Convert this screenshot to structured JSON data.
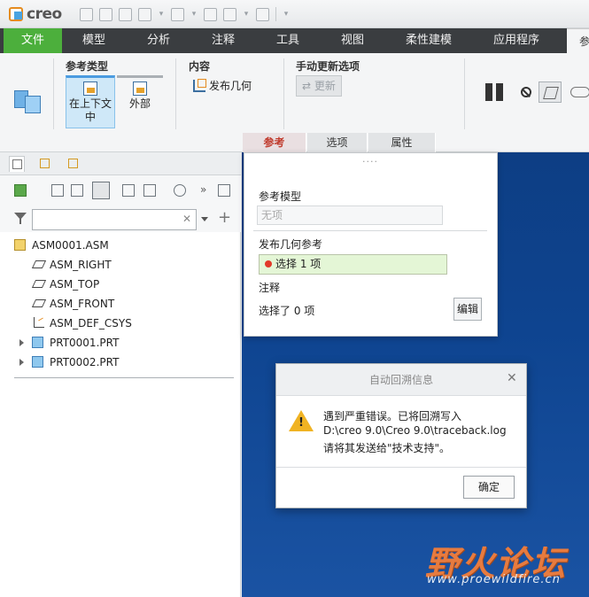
{
  "app": {
    "logo_text": "creo"
  },
  "menu": {
    "file": "文件",
    "tabs": [
      "模型",
      "分析",
      "注释",
      "工具",
      "视图",
      "柔性建模",
      "应用程序"
    ],
    "partial_tab": "参"
  },
  "ribbon": {
    "ref_type_title": "参考类型",
    "ref_in_context": "在上下文中",
    "ref_external": "外部",
    "content_title": "内容",
    "publish_geometry": "发布几何",
    "manual_update_title": "手动更新选项",
    "refresh": "更新",
    "subtabs": [
      "参考",
      "选项",
      "属性"
    ]
  },
  "left_panel": {
    "search_placeholder": "",
    "tree": [
      {
        "label": "ASM0001.ASM",
        "icon": "assembly-icon"
      },
      {
        "label": "ASM_RIGHT",
        "icon": "datum-plane-icon"
      },
      {
        "label": "ASM_TOP",
        "icon": "datum-plane-icon"
      },
      {
        "label": "ASM_FRONT",
        "icon": "datum-plane-icon"
      },
      {
        "label": "ASM_DEF_CSYS",
        "icon": "csys-icon"
      },
      {
        "label": "PRT0001.PRT",
        "icon": "part-icon"
      },
      {
        "label": "PRT0002.PRT",
        "icon": "part-icon"
      }
    ]
  },
  "flyout": {
    "ref_model_label": "参考模型",
    "ref_model_value": "无项",
    "publish_ref_label": "发布几何参考",
    "selection": "选择 1 项",
    "notes_label": "注释",
    "selected_count": "选择了 0 项",
    "edit_button": "编辑"
  },
  "dialog": {
    "title": "自动回溯信息",
    "line1": "遇到严重错误。已将回溯写入",
    "line2": "D:\\creo 9.0\\Creo 9.0\\traceback.log",
    "line3": "请将其发送给\"技术支持\"。",
    "ok": "确定"
  },
  "watermark": {
    "title": "野火论坛",
    "url": "www.proewildfire.cn"
  }
}
